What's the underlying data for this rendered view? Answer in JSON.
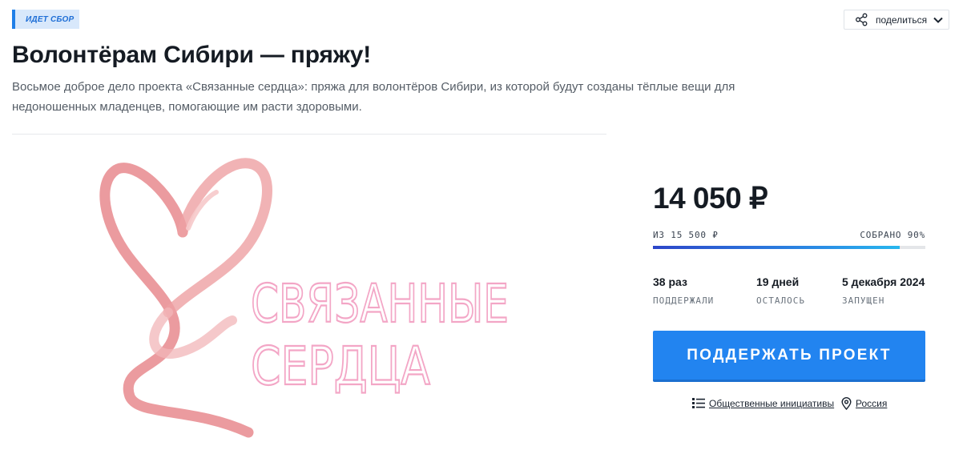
{
  "campaign": {
    "status": "ИДЕТ СБОР",
    "share_label": "поделиться",
    "title": "Волонтёрам Сибири — пряжу!",
    "description": "Восьмое доброе дело проекта «Связанные сердца»: пряжа для волонтёров Сибири, из которой будут созданы тёплые вещи для недоношенных младенцев, помогающие им расти здоровыми."
  },
  "cover": {
    "logo_line1": "СВЯЗАННЫЕ",
    "logo_line2": "СЕРДЦА",
    "ribbon_color": "#e88a8e",
    "logo_text_color": "#f3a6c6"
  },
  "funding": {
    "collected": "14 050 ₽",
    "goal_text": "ИЗ 15 500 ₽",
    "collected_text": "СОБРАНО 90%",
    "progress_fraction": 0.907
  },
  "stats": [
    {
      "value": "38 раз",
      "label": "ПОДДЕРЖАЛИ"
    },
    {
      "value": "19 дней",
      "label": "ОСТАЛОСЬ"
    },
    {
      "value": "5 декабря 2024",
      "label": "ЗАПУЩЕН"
    }
  ],
  "support_button_label": "ПОДДЕРЖАТЬ ПРОЕКТ",
  "meta": {
    "category": "Общественные инициативы",
    "category_icon": "list-icon",
    "region": "Россия",
    "region_icon": "location-pin-icon"
  },
  "colors": {
    "accent": "#2284f0",
    "badge_bg": "#d8e8fb",
    "badge_text": "#1f6fd6"
  }
}
